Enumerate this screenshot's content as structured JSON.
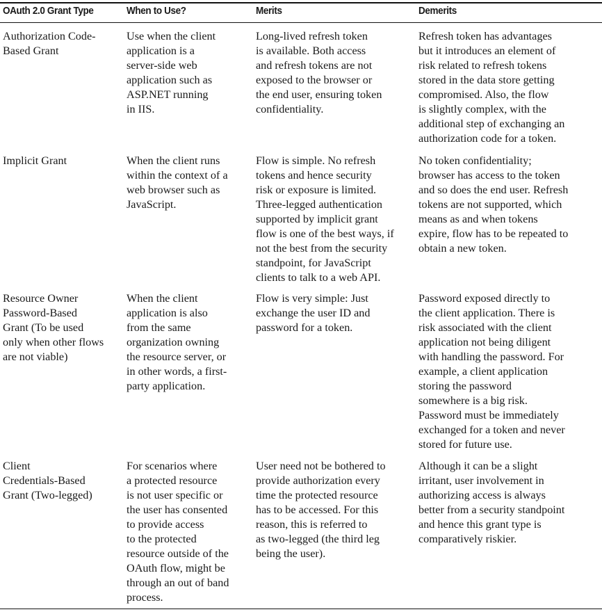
{
  "table": {
    "headers": [
      "OAuth 2.0 Grant Type",
      "When to Use?",
      "Merits",
      "Demerits"
    ],
    "rows": [
      {
        "cells": [
          "Authorization Code-\nBased Grant",
          "Use when the client\napplication is a\nserver-side web\napplication such as\nASP.NET running\nin IIS.",
          "Long-lived refresh token\nis available. Both access\nand refresh tokens are not\nexposed to the browser or\nthe end user, ensuring token\nconfidentiality.",
          "Refresh token has advantages\nbut it introduces an element of\nrisk related to refresh tokens\nstored in the data store getting\ncompromised. Also, the flow\nis slightly complex, with the\nadditional step of exchanging an\nauthorization code for a token."
        ]
      },
      {
        "cells": [
          "Implicit Grant",
          "When the client runs\nwithin the context of a\nweb browser such as\nJavaScript.",
          "Flow is simple. No refresh\ntokens and hence security\nrisk or exposure is limited.\nThree-legged authentication\nsupported by implicit grant\nflow is one of the best ways, if\nnot the best from the security\nstandpoint, for JavaScript\nclients to talk to a web API.",
          "No token confidentiality;\nbrowser has access to the token\nand so does the end user. Refresh\ntokens are not supported, which\nmeans as and when tokens\nexpire, flow has to be repeated to\nobtain a new token."
        ]
      },
      {
        "cells": [
          "Resource Owner\nPassword-Based\nGrant (To be used\nonly when other flows\nare not viable)",
          "When the client\napplication is also\nfrom the same\norganization owning\nthe resource server, or\nin other words, a first-\nparty application.",
          "Flow is very simple: Just\nexchange the user ID and\npassword for a token.",
          "Password exposed directly to\nthe client application. There is\nrisk associated with the client\napplication not being diligent\nwith handling the password. For\nexample, a client application\nstoring the password\nsomewhere is a big risk.\nPassword must be immediately\nexchanged for a token and never\nstored for future use."
        ]
      },
      {
        "cells": [
          "Client\nCredentials-Based\nGrant (Two-legged)",
          "For scenarios where\na protected resource\nis not user specific or\nthe user has consented\nto provide access\nto the protected\nresource outside of the\nOAuth flow, might be\nthrough an out of band\nprocess.",
          "User need not be bothered to\nprovide authorization every\ntime the protected resource\nhas to be accessed. For this\nreason, this is referred to\nas two-legged (the third leg\nbeing the user).",
          "Although it can be a slight\nirritant, user involvement in\nauthorizing access is always\nbetter from a security standpoint\nand hence this grant type is\ncomparatively riskier."
        ]
      }
    ]
  }
}
